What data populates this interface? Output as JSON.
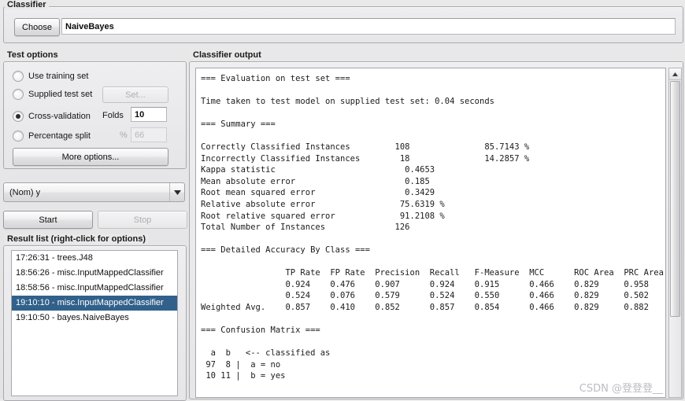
{
  "classifier": {
    "panel_title": "Classifier",
    "choose_label": "Choose",
    "selected_classifier": "NaiveBayes"
  },
  "test_options": {
    "panel_title": "Test options",
    "use_training_set": "Use training set",
    "supplied_test_set": "Supplied test set",
    "set_button": "Set...",
    "cross_validation": "Cross-validation",
    "folds_label": "Folds",
    "folds_value": "10",
    "percentage_split": "Percentage split",
    "percent_label": "%",
    "percent_value": "66",
    "more_options": "More options..."
  },
  "class_attribute": {
    "selected": "(Nom) y"
  },
  "actions": {
    "start": "Start",
    "stop": "Stop"
  },
  "result_list": {
    "panel_title": "Result list (right-click for options)",
    "items": [
      {
        "label": "17:26:31 - trees.J48",
        "selected": false
      },
      {
        "label": "18:56:26 - misc.InputMappedClassifier",
        "selected": false
      },
      {
        "label": "18:58:56 - misc.InputMappedClassifier",
        "selected": false
      },
      {
        "label": "19:10:10 - misc.InputMappedClassifier",
        "selected": true
      },
      {
        "label": "19:10:50 - bayes.NaiveBayes",
        "selected": false
      }
    ]
  },
  "output": {
    "panel_title": "Classifier output",
    "text": "=== Evaluation on test set ===\n\nTime taken to test model on supplied test set: 0.04 seconds\n\n=== Summary ===\n\nCorrectly Classified Instances         108               85.7143 %\nIncorrectly Classified Instances        18               14.2857 %\nKappa statistic                          0.4653\nMean absolute error                      0.185\nRoot mean squared error                  0.3429\nRelative absolute error                 75.6319 %\nRoot relative squared error             91.2108 %\nTotal Number of Instances              126\n\n=== Detailed Accuracy By Class ===\n\n                 TP Rate  FP Rate  Precision  Recall   F-Measure  MCC      ROC Area  PRC Area  Cla\n                 0.924    0.476    0.907      0.924    0.915      0.466    0.829     0.958     no\n                 0.524    0.076    0.579      0.524    0.550      0.466    0.829     0.502     yes\nWeighted Avg.    0.857    0.410    0.852      0.857    0.854      0.466    0.829     0.882\n\n=== Confusion Matrix ===\n\n  a  b   <-- classified as\n 97  8 |  a = no\n 10 11 |  b = yes\n"
  },
  "watermark": {
    "text": "CSDN @登登登__"
  }
}
